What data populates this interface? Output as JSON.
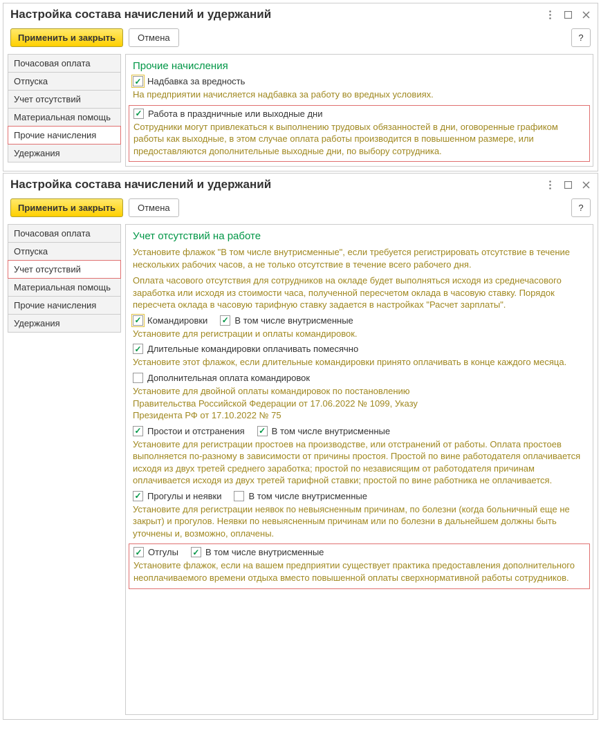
{
  "w1": {
    "title": "Настройка состава начислений и удержаний",
    "apply_label": "Применить и закрыть",
    "cancel_label": "Отмена",
    "help_label": "?",
    "sidebar": {
      "items": [
        {
          "label": "Почасовая оплата"
        },
        {
          "label": "Отпуска"
        },
        {
          "label": "Учет отсутствий"
        },
        {
          "label": "Материальная помощь"
        },
        {
          "label": "Прочие начисления"
        },
        {
          "label": "Удержания"
        }
      ]
    },
    "section_title": "Прочие начисления",
    "chk1_label": "Надбавка за вредность",
    "desc1": "На предприятии начисляется надбавка за работу во вредных условиях.",
    "chk2_label": "Работа в праздничные или выходные дни",
    "desc2": "Сотрудники могут привлекаться к выполнению трудовых обязанностей в дни, оговоренные графиком работы как выходные, в этом случае оплата работы производится в повышенном размере, или предоставляются дополнительные выходные дни, по выбору сотрудника."
  },
  "w2": {
    "title": "Настройка состава начислений и удержаний",
    "apply_label": "Применить и закрыть",
    "cancel_label": "Отмена",
    "help_label": "?",
    "sidebar": {
      "items": [
        {
          "label": "Почасовая оплата"
        },
        {
          "label": "Отпуска"
        },
        {
          "label": "Учет отсутствий"
        },
        {
          "label": "Материальная помощь"
        },
        {
          "label": "Прочие начисления"
        },
        {
          "label": "Удержания"
        }
      ]
    },
    "section_title": "Учет отсутствий на работе",
    "intro1": "Установите флажок \"В том числе внутрисменные\", если требуется регистрировать отсутствие в течение нескольких рабочих часов, а не только отсутствие в течение всего рабочего дня.",
    "intro2": "Оплата часового отсутствия для сотрудников на окладе будет выполняться исходя из среднечасового заработка или исходя из стоимости часа, полученной пересчетом оклада в часовую ставку. Порядок пересчета оклада в часовую тарифную ставку задается в настройках \"Расчет зарплаты\".",
    "chk_trips_label": "Командировки",
    "chk_trips_intra_label": "В том числе внутрисменные",
    "desc_trips": "Установите для регистрации и оплаты командировок.",
    "chk_long_trips_label": "Длительные командировки оплачивать помесячно",
    "desc_long_trips": "Установите этот флажок, если длительные командировки принято оплачивать в конце каждого месяца.",
    "chk_extra_pay_label": "Дополнительная оплата командировок",
    "desc_extra_pay": "Установите для двойной оплаты командировок по постановлению Правительства Российской Федерации от 17.06.2022 № 1099, Указу Президента РФ от 17.10.2022 № 75",
    "chk_idle_label": "Простои и отстранения",
    "chk_idle_intra_label": "В том числе внутрисменные",
    "desc_idle": "Установите для регистрации простоев на производстве, или отстранений от работы. Оплата простоев выполняется по-разному в зависимости от причины простоя. Простой по вине работодателя оплачивается исходя из двух третей среднего заработка; простой по независящим от работодателя причинам оплачивается исходя из двух третей тарифной ставки; простой по вине работника не оплачивается.",
    "chk_absent_label": "Прогулы и неявки",
    "chk_absent_intra_label": "В том числе внутрисменные",
    "desc_absent": "Установите для регистрации неявок по невыясненным причинам, по болезни (когда больничный еще не закрыт) и прогулов. Неявки по невыясненным причинам или по болезни в дальнейшем должны быть уточнены и, возможно, оплачены.",
    "chk_compoff_label": "Отгулы",
    "chk_compoff_intra_label": "В том числе внутрисменные",
    "desc_compoff": "Установите флажок, если на вашем предприятии существует практика предоставления дополнительного неоплачиваемого времени отдыха вместо повышенной оплаты сверхнормативной работы сотрудников."
  }
}
